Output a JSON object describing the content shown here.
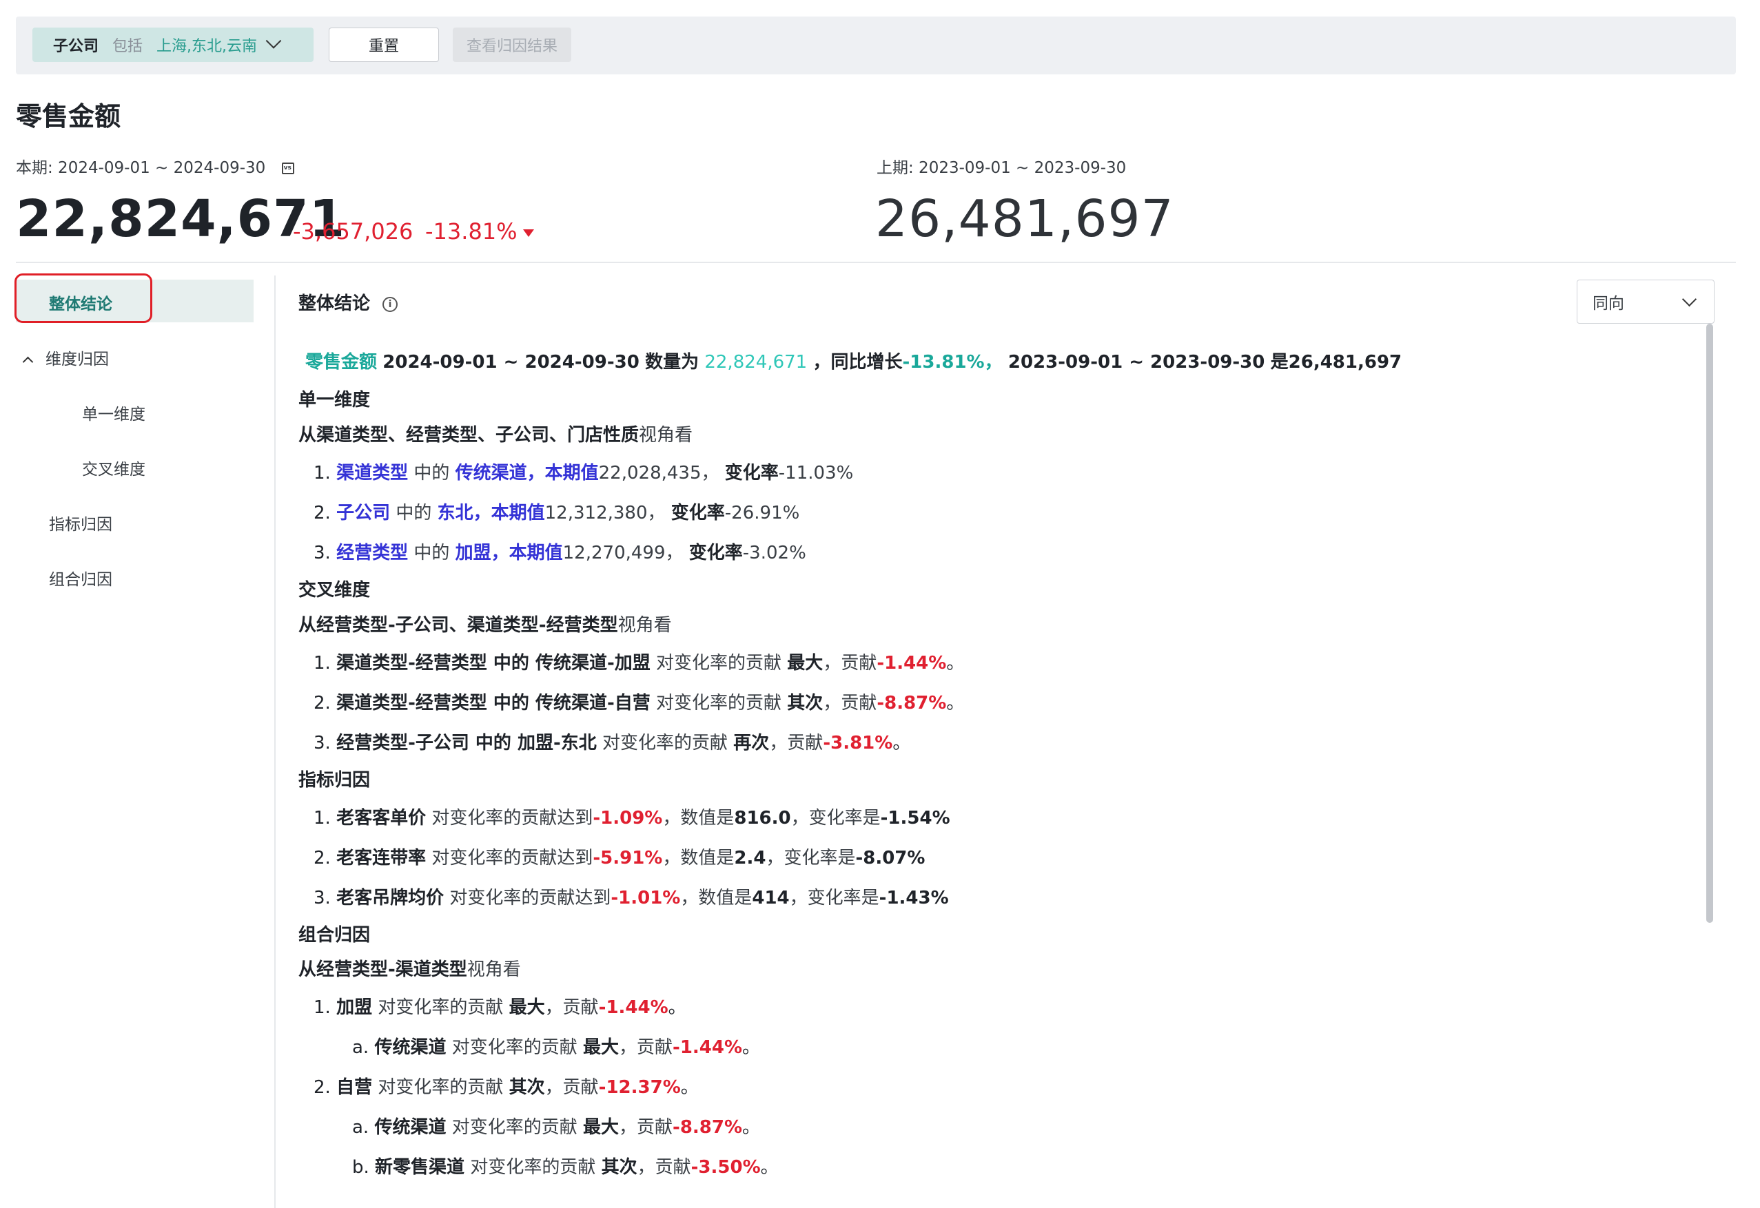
{
  "filter": {
    "key": "子公司",
    "op": "包括",
    "value": "上海,东北,云南",
    "reset_label": "重置",
    "view_label": "查看归因结果"
  },
  "title": "零售金额",
  "current": {
    "period": "本期: 2024-09-01 ~ 2024-09-30",
    "value": "22,824,671",
    "delta_abs": "-3,657,026",
    "delta_pct": "-13.81%"
  },
  "previous": {
    "period": "上期: 2023-09-01 ~ 2023-09-30",
    "value": "26,481,697"
  },
  "sidebar": {
    "items": [
      {
        "label": "整体结论"
      },
      {
        "label": "维度归因"
      },
      {
        "label": "单一维度"
      },
      {
        "label": "交叉维度"
      },
      {
        "label": "指标归因"
      },
      {
        "label": "组合归因"
      }
    ]
  },
  "content": {
    "title": "整体结论",
    "select_value": "同向",
    "summary": {
      "metric": "零售金额",
      "range1": "2024-09-01 ~ 2024-09-30",
      "count_label": "数量为",
      "value": "22,824,671",
      "growth_label": "，同比增长",
      "growth": "-13.81%，",
      "range2": "2023-09-01 ~ 2023-09-30",
      "is": "是",
      "prev_value": "26,481,697"
    },
    "single": {
      "heading": "单一维度",
      "view_a": "从渠道类型、经营类型、子公司、门店性质",
      "view_b": "视角看",
      "items": [
        {
          "num": "1.",
          "dim": "渠道类型",
          "mid": " 中的 ",
          "member": "传统渠道，本期值",
          "val": "22,028,435，",
          "rate_label": "变化率",
          "rate": "-11.03%"
        },
        {
          "num": "2.",
          "dim": "子公司",
          "mid": " 中的 ",
          "member": "东北，本期值",
          "val": "12,312,380，",
          "rate_label": "变化率",
          "rate": "-26.91%"
        },
        {
          "num": "3.",
          "dim": "经营类型",
          "mid": " 中的 ",
          "member": "加盟，本期值",
          "val": "12,270,499，",
          "rate_label": "变化率",
          "rate": "-3.02%"
        }
      ]
    },
    "cross": {
      "heading": "交叉维度",
      "view_a": "从经营类型-子公司、渠道类型-经营类型",
      "view_b": "视角看",
      "items": [
        {
          "num": "1.",
          "name": "渠道类型-经营类型 中的 传统渠道-加盟",
          "mid": " 对变化率的贡献 ",
          "rank": "最大",
          "c_label": "，贡献",
          "contrib": "-1.44%",
          "end": "。"
        },
        {
          "num": "2.",
          "name": "渠道类型-经营类型 中的 传统渠道-自营",
          "mid": " 对变化率的贡献 ",
          "rank": "其次",
          "c_label": "，贡献",
          "contrib": "-8.87%",
          "end": "。"
        },
        {
          "num": "3.",
          "name": "经营类型-子公司 中的 加盟-东北",
          "mid": " 对变化率的贡献 ",
          "rank": "再次",
          "c_label": "，贡献",
          "contrib": "-3.81%",
          "end": "。"
        }
      ]
    },
    "metric": {
      "heading": "指标归因",
      "items": [
        {
          "num": "1.",
          "name": "老客客单价",
          "mid": " 对变化率的贡献达到",
          "contrib": "-1.09%",
          "v_label": "，数值是",
          "v": "816.0",
          "r_label": "，变化率是",
          "r": "-1.54%"
        },
        {
          "num": "2.",
          "name": "老客连带率",
          "mid": " 对变化率的贡献达到",
          "contrib": "-5.91%",
          "v_label": "，数值是",
          "v": "2.4",
          "r_label": "，变化率是",
          "r": "-8.07%"
        },
        {
          "num": "3.",
          "name": "老客吊牌均价",
          "mid": " 对变化率的贡献达到",
          "contrib": "-1.01%",
          "v_label": "，数值是",
          "v": "414",
          "r_label": "，变化率是",
          "r": "-1.43%"
        }
      ]
    },
    "combo": {
      "heading": "组合归因",
      "view_a": "从经营类型-渠道类型",
      "view_b": "视角看",
      "items": [
        {
          "num": "1.",
          "name": "加盟",
          "mid": " 对变化率的贡献 ",
          "rank": "最大",
          "c_label": "，贡献",
          "contrib": "-1.44%",
          "end": "。"
        },
        {
          "num": "a.",
          "name": "传统渠道",
          "mid": " 对变化率的贡献 ",
          "rank": "最大",
          "c_label": "，贡献",
          "contrib": "-1.44%",
          "end": "。"
        },
        {
          "num": "2.",
          "name": "自营",
          "mid": " 对变化率的贡献 ",
          "rank": "其次",
          "c_label": "，贡献",
          "contrib": "-12.37%",
          "end": "。"
        },
        {
          "num": "a.",
          "name": "传统渠道",
          "mid": " 对变化率的贡献 ",
          "rank": "最大",
          "c_label": "，贡献",
          "contrib": "-8.87%",
          "end": "。"
        },
        {
          "num": "b.",
          "name": "新零售渠道",
          "mid": " 对变化率的贡献 ",
          "rank": "其次",
          "c_label": "，贡献",
          "contrib": "-3.50%",
          "end": "。"
        }
      ]
    }
  },
  "colors": {
    "accent": "#2fc7b8",
    "negative": "#e02030",
    "link": "#3433d6",
    "active_nav_bg": "#e7efee"
  },
  "icons": {
    "filter_chevron": "chevron-down-icon",
    "compare": "vs-calendar-icon",
    "down": "triangle-down-icon",
    "info": "info-icon",
    "collapse": "chevron-up-icon"
  }
}
